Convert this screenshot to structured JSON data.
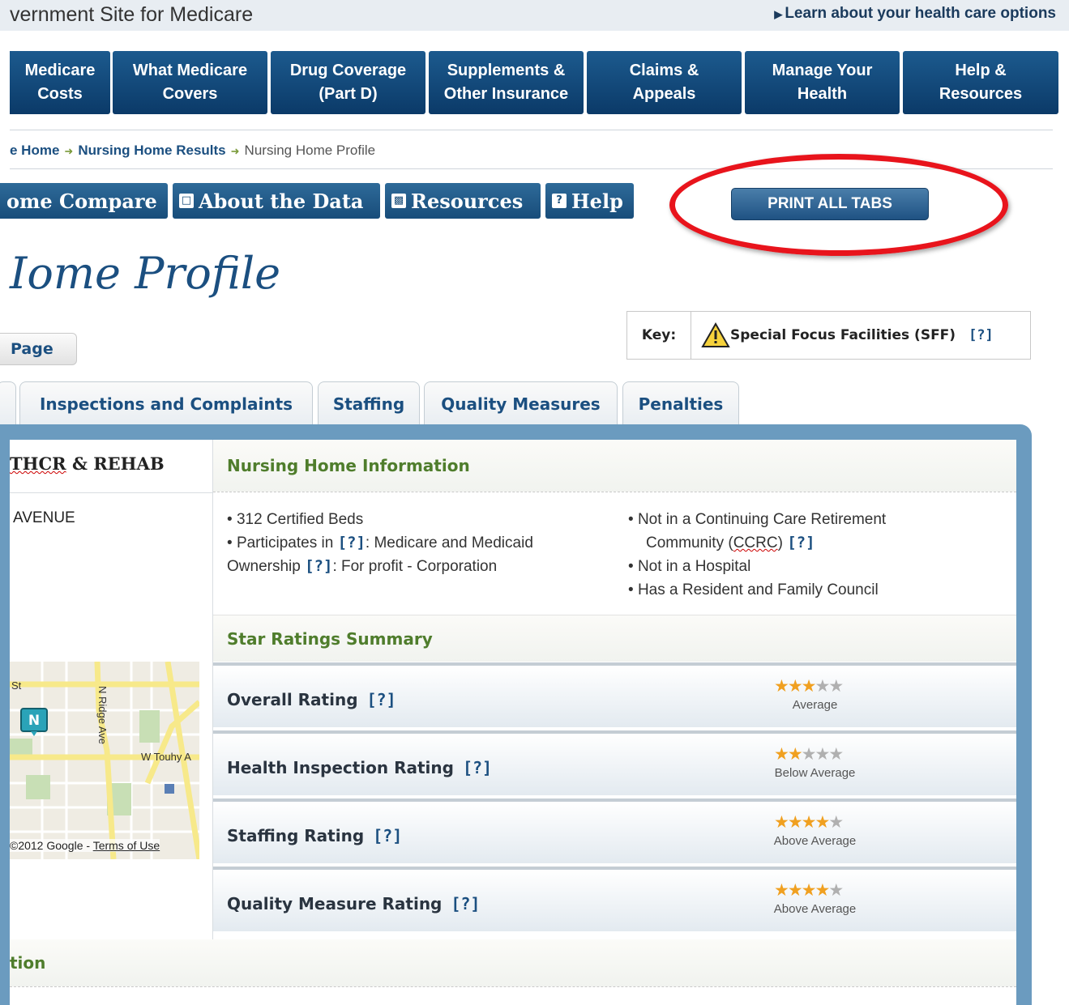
{
  "header": {
    "site_title": "vernment Site for Medicare",
    "learn_link": "Learn about your health care options"
  },
  "nav": {
    "items": [
      {
        "label": "Medicare\nCosts"
      },
      {
        "label": "What Medicare\nCovers"
      },
      {
        "label": "Drug Coverage\n(Part D)"
      },
      {
        "label": "Supplements &\nOther Insurance"
      },
      {
        "label": "Claims &\nAppeals"
      },
      {
        "label": "Manage Your\nHealth"
      },
      {
        "label": "Help &\nResources"
      }
    ]
  },
  "breadcrumb": {
    "home": "e Home",
    "results": "Nursing Home Results",
    "current": "Nursing Home Profile"
  },
  "toolbar": {
    "compare": "ome Compare",
    "about": "About the Data",
    "resources": "Resources",
    "help": "Help",
    "print_all": "PRINT ALL TABS"
  },
  "page": {
    "title": "Iome Profile",
    "page_button": "Page"
  },
  "key": {
    "label": "Key:",
    "sff": "Special Focus Facilities (SFF)",
    "help": "[?]"
  },
  "tabs": [
    {
      "label": "Inspections and Complaints"
    },
    {
      "label": "Staffing"
    },
    {
      "label": "Quality Measures"
    },
    {
      "label": "Penalties"
    }
  ],
  "facility": {
    "name_part": "THCR",
    "name_rest": " & REHAB",
    "street": "AVENUE",
    "map_credit": "©2012 Google - ",
    "map_terms": "Terms of Use",
    "map_labels": {
      "street1": "St",
      "street2": "N Ridge Ave",
      "street3": "W Touhy A",
      "marker": "N"
    }
  },
  "info": {
    "heading": "Nursing Home Information",
    "beds": "312 Certified Beds",
    "participates_label": "Participates in",
    "participates_value": ": Medicare and Medicaid",
    "ownership_label": "Ownership",
    "ownership_value": ": For profit - Corporation",
    "ccrc_line1": "Not in a Continuing Care Retirement",
    "ccrc_line2a": "Community (",
    "ccrc_abbr": "CCRC",
    "ccrc_line2b": ")",
    "hospital": "Not in a Hospital",
    "council": "Has a Resident and Family Council",
    "help": "[?]"
  },
  "summary": {
    "heading": "Star Ratings Summary",
    "ratings": [
      {
        "label": "Overall Rating",
        "stars": 3,
        "text": "Average"
      },
      {
        "label": "Health Inspection Rating",
        "stars": 2,
        "text": "Below Average"
      },
      {
        "label": "Staffing Rating",
        "stars": 4,
        "text": "Above Average"
      },
      {
        "label": "Quality Measure Rating",
        "stars": 4,
        "text": "Above Average"
      }
    ],
    "help": "[?]"
  },
  "bottom": {
    "heading": "tion"
  }
}
